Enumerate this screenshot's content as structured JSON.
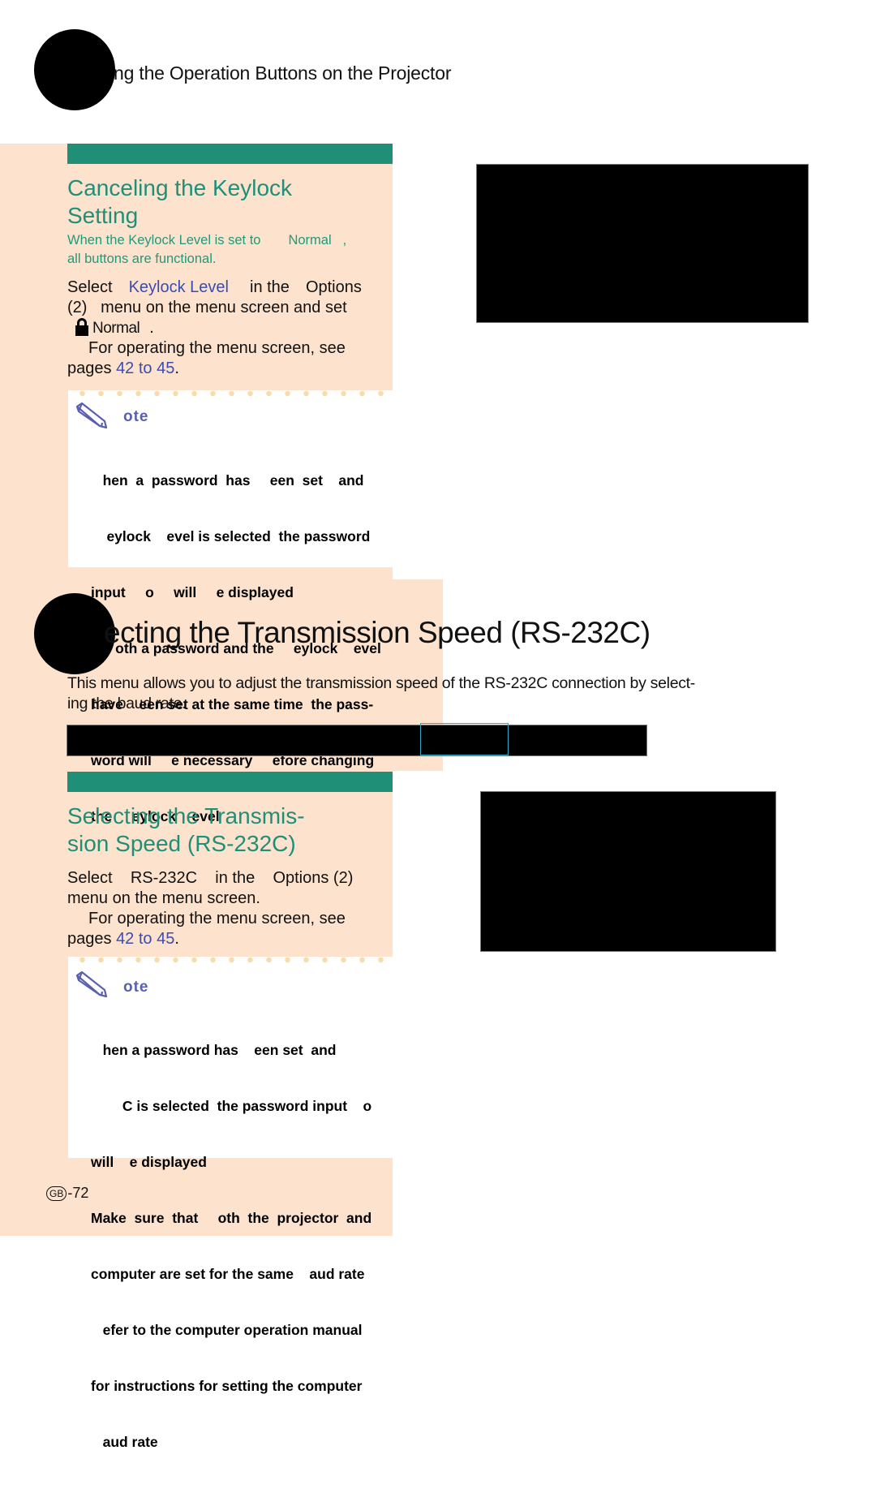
{
  "running_head": "ng the Operation Buttons on the Projector",
  "keylock_section": {
    "title_line1": "Canceling the Keylock",
    "title_line2": "Setting",
    "lead_line1_a": "When the Keylock Level is set to",
    "lead_line1_b": "Normal",
    "lead_line1_c": ",",
    "lead_line2": "all buttons are functional.",
    "step": {
      "select": "Select",
      "item": "Keylock Level",
      "in_the": "in the",
      "menu": "Options",
      "line2": "(2)   menu on the menu screen and set",
      "value": "Normal",
      "period": ".",
      "see_line": "For operating the menu screen, see",
      "pages": "pages",
      "pages_link": "42 to 45",
      "pages_end": "."
    },
    "note": {
      "label": "ote",
      "lines": [
        "   hen  a  password  has     een  set    and",
        "    eylock    evel is selected  the password",
        "input     o     will     e displayed",
        "If    oth a password and the     eylock    evel",
        "have    een set at the same time  the pass-",
        "word will     e necessary     efore changing",
        "the     eylock    evel"
      ]
    }
  },
  "transmission_section": {
    "title": "ecting the Transmission Speed (RS-232C)",
    "intro_line1": "This menu allows you to adjust the transmission speed of the RS-232C connection by select-",
    "intro_line2": "ing the baud rate.",
    "subsection": {
      "title_line1": "Selecting the Transmis-",
      "title_line2": "sion Speed (RS-232C)",
      "line1": "Select    RS-232C    in the    Options (2)",
      "line2": "menu on the menu screen.",
      "see_line": "For operating the menu screen, see",
      "pages": "pages",
      "pages_link": "42 to 45",
      "pages_end": "."
    },
    "note": {
      "label": "ote",
      "lines": [
        "   hen a password has    een set  and",
        "        C is selected  the password input    o",
        "will    e displayed",
        "Make  sure  that     oth  the  projector  and",
        "computer are set for the same    aud rate",
        "   efer to the computer operation manual",
        "for instructions for setting the computer",
        "   aud rate"
      ]
    }
  },
  "footer": {
    "region_badge": "GB",
    "page_number": "-72"
  },
  "colors": {
    "accent_green": "#1f8f78",
    "beige_panel": "#fde3cd",
    "link_blue": "#3a4cb0",
    "note_label": "#5a5fb0"
  }
}
